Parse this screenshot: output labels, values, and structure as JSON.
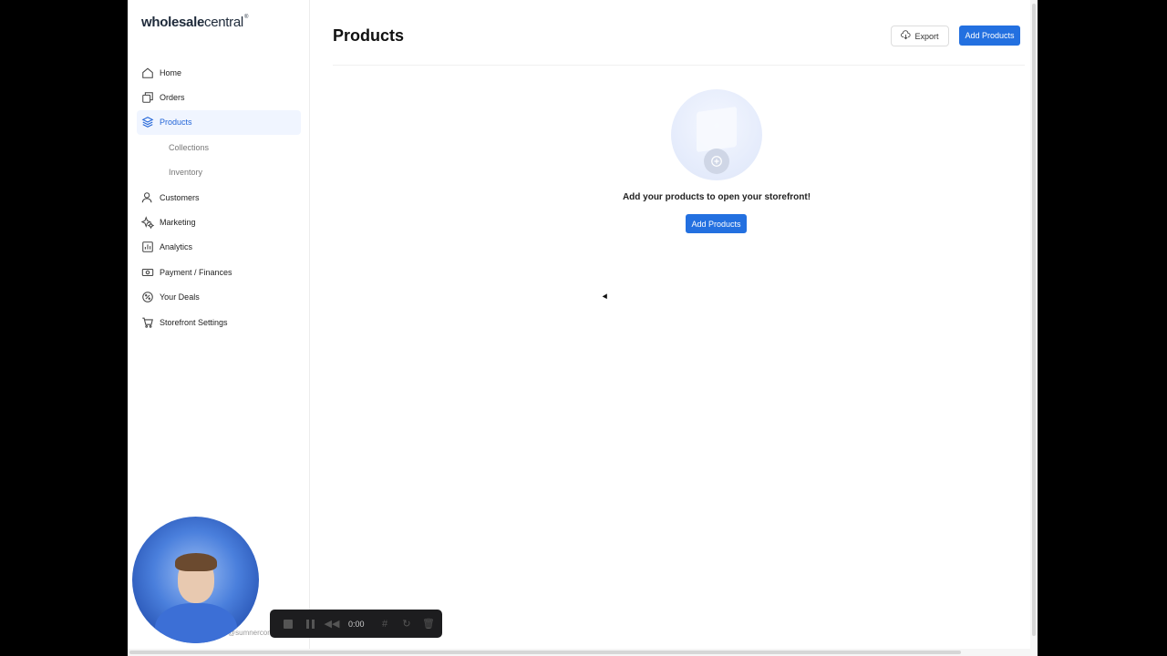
{
  "brand": {
    "name_bold": "wholesale",
    "name_light": "central",
    "reg": "®"
  },
  "sidebar": {
    "items": [
      {
        "label": "Home",
        "icon": "home-icon"
      },
      {
        "label": "Orders",
        "icon": "orders-icon"
      },
      {
        "label": "Products",
        "icon": "layers-icon",
        "active": true
      },
      {
        "label": "Collections",
        "sub": true
      },
      {
        "label": "Inventory",
        "sub": true
      },
      {
        "label": "Customers",
        "icon": "user-icon"
      },
      {
        "label": "Marketing",
        "icon": "sparkle-icon"
      },
      {
        "label": "Analytics",
        "icon": "chart-icon"
      },
      {
        "label": "Payment / Finances",
        "icon": "money-icon"
      },
      {
        "label": "Your Deals",
        "icon": "percent-icon"
      },
      {
        "label": "Storefront Settings",
        "icon": "cart-icon"
      }
    ]
  },
  "header": {
    "title": "Products",
    "export_label": "Export",
    "add_label": "Add Products"
  },
  "empty_state": {
    "message": "Add your products to open your storefront!",
    "button_label": "Add Products"
  },
  "recorder": {
    "time": "0:00"
  },
  "user": {
    "email_fragment": "@sumnercon"
  },
  "colors": {
    "primary": "#2370e0",
    "active_bg": "#f0f5ff",
    "active_text": "#2466d8"
  }
}
